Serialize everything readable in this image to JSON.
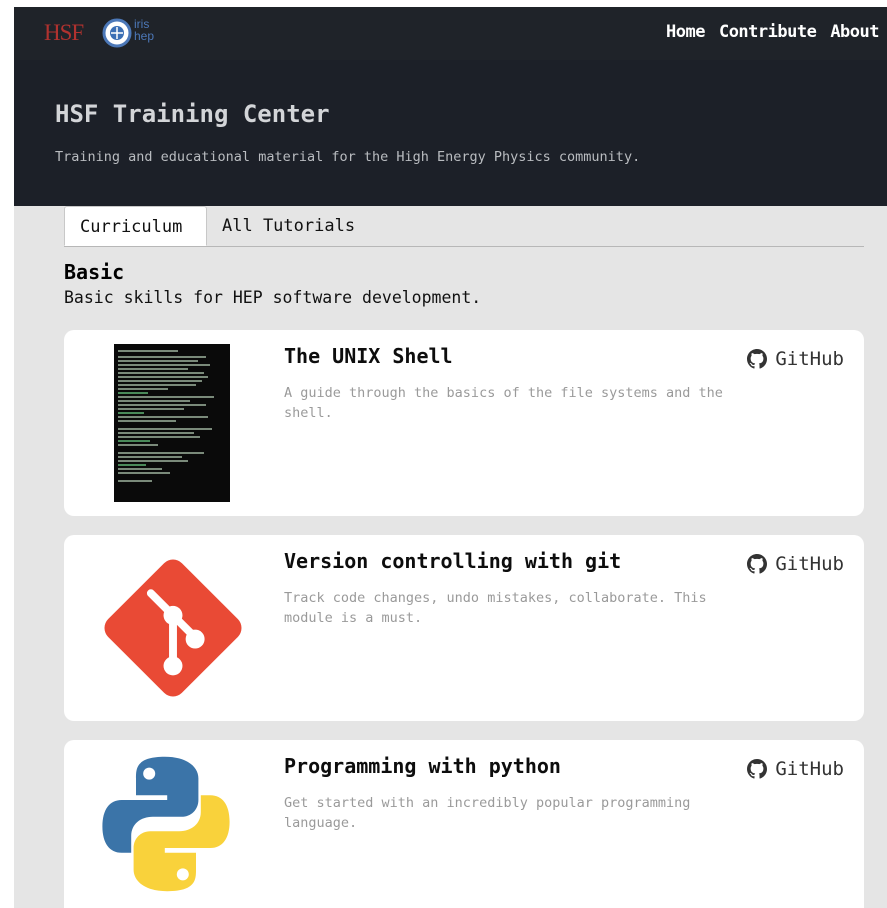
{
  "navbar": {
    "logo_hsf": "HSF",
    "logo_iris_top": "iris",
    "logo_iris_bottom": "hep",
    "links": [
      "Home",
      "Contribute",
      "About"
    ]
  },
  "hero": {
    "title": "HSF Training Center",
    "subtitle": "Training and educational material for the High Energy Physics community."
  },
  "tabs": [
    "Curriculum",
    "All Tutorials"
  ],
  "active_tab": "Curriculum",
  "section": {
    "title": "Basic",
    "description": "Basic skills for HEP software development."
  },
  "cards": [
    {
      "title": "The UNIX Shell",
      "description": "A guide through the basics of the file systems and the shell.",
      "link_label": "GitHub",
      "thumbnail": "terminal-screenshot"
    },
    {
      "title": "Version controlling with git",
      "description": "Track code changes, undo mistakes, collaborate. This module is a must.",
      "link_label": "GitHub",
      "thumbnail": "git-logo"
    },
    {
      "title": "Programming with python",
      "description": "Get started with an incredibly popular programming language.",
      "link_label": "GitHub",
      "thumbnail": "python-logo"
    }
  ],
  "colors": {
    "navbar_bg": "#1f2329",
    "hero_bg": "#1c2028",
    "page_bg": "#e5e5e5",
    "git_red": "#e94a35",
    "python_blue": "#3b74a8",
    "python_yellow": "#f9d23b",
    "hsf_red": "#b0322f"
  }
}
